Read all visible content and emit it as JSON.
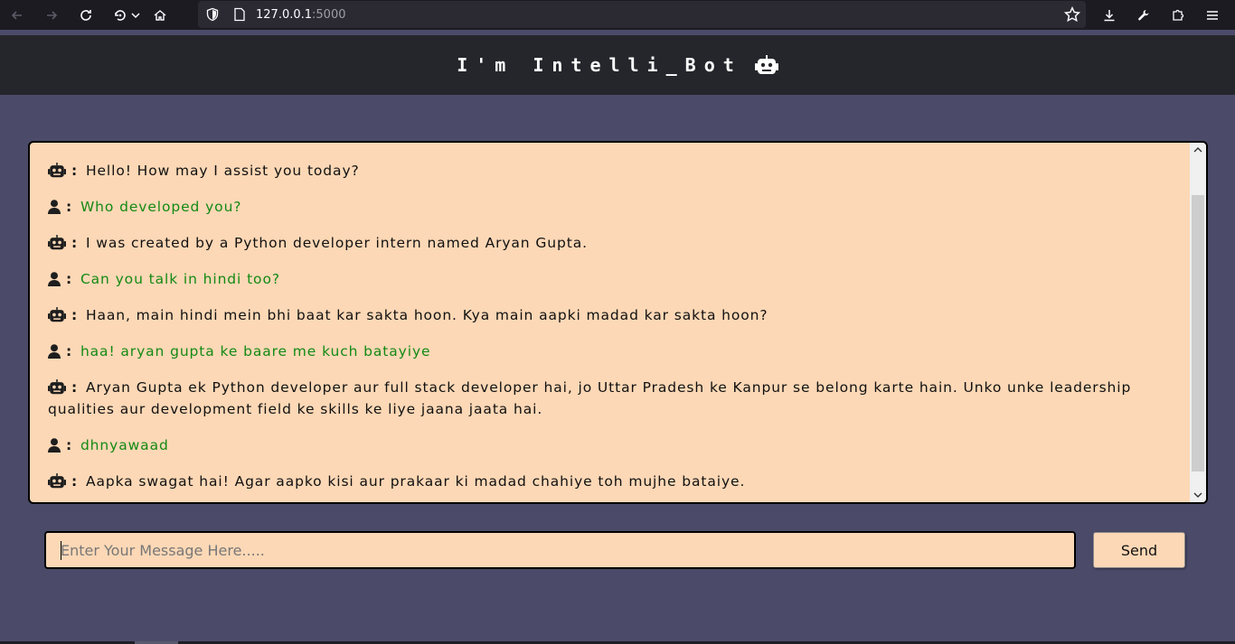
{
  "browser": {
    "url_host": "127.0.0.1",
    "url_port": ":5000"
  },
  "header": {
    "title": "I'm Intelli_Bot",
    "icon": "robot-icon"
  },
  "chat": {
    "messages": [
      {
        "sender": "bot",
        "icon": "robot-icon",
        "text": "Hello! How may I assist you today?"
      },
      {
        "sender": "user",
        "icon": "user-icon",
        "text": "Who developed you?"
      },
      {
        "sender": "bot",
        "icon": "robot-icon",
        "text": "I was created by a Python developer intern named Aryan Gupta."
      },
      {
        "sender": "user",
        "icon": "user-icon",
        "text": "Can you talk in hindi too?"
      },
      {
        "sender": "bot",
        "icon": "robot-icon",
        "text": "Haan, main hindi mein bhi baat kar sakta hoon. Kya main aapki madad kar sakta hoon?"
      },
      {
        "sender": "user",
        "icon": "user-icon",
        "text": "haa! aryan gupta ke baare me kuch batayiye"
      },
      {
        "sender": "bot",
        "icon": "robot-icon",
        "text": "Aryan Gupta ek Python developer aur full stack developer hai, jo Uttar Pradesh ke Kanpur se belong karte hain. Unko unke leadership qualities aur development field ke skills ke liye jaana jaata hai."
      },
      {
        "sender": "user",
        "icon": "user-icon",
        "text": "dhnyawaad"
      },
      {
        "sender": "bot",
        "icon": "robot-icon",
        "text": "Aapka swagat hai! Agar aapko kisi aur prakaar ki madad chahiye toh mujhe bataiye."
      }
    ]
  },
  "composer": {
    "placeholder": "Enter Your Message Here.....",
    "value": "",
    "send_label": "Send"
  },
  "colors": {
    "page_bg": "#4b4b69",
    "header_bg": "#25262b",
    "chat_bg": "#fdd8b6",
    "user_text": "#138a14"
  }
}
